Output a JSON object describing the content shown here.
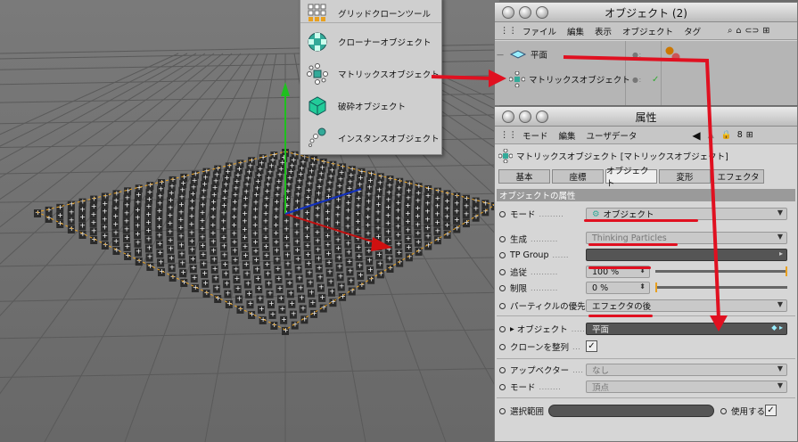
{
  "popup": {
    "items": [
      {
        "label": "グリッドクローンツール",
        "icon": "grid-clone-icon"
      },
      {
        "label": "クローナーオブジェクト",
        "icon": "cloner-icon"
      },
      {
        "label": "マトリックスオブジェクト",
        "icon": "matrix-icon"
      },
      {
        "label": "破砕オブジェクト",
        "icon": "fracture-icon"
      },
      {
        "label": "インスタンスオブジェクト",
        "icon": "instance-icon"
      }
    ]
  },
  "objects_window": {
    "title": "オブジェクト (2)",
    "menu": [
      "ファイル",
      "編集",
      "表示",
      "オブジェクト",
      "タグ"
    ],
    "rows": [
      {
        "name": "平面"
      },
      {
        "name": "マトリックスオブジェクト"
      }
    ]
  },
  "attributes": {
    "title": "属性",
    "menu": [
      "モード",
      "編集",
      "ユーザデータ"
    ],
    "object_header": "マトリックスオブジェクト [マトリックスオブジェクト]",
    "tabs": [
      "基本",
      "座標",
      "オブジェクト",
      "変形",
      "エフェクタ"
    ],
    "active_tab": "オブジェクト",
    "section": "オブジェクトの属性",
    "fields": {
      "mode_label": "モード",
      "mode_value": "オブジェクト",
      "gen_label": "生成",
      "gen_value": "Thinking Particles",
      "tp_label": "TP Group",
      "follow_label": "追従",
      "follow_value": "100 %",
      "limit_label": "制限",
      "limit_value": "0 %",
      "priority_label": "パーティクルの優先",
      "priority_value": "エフェクタの後",
      "object_label": "オブジェクト",
      "object_value": "平面",
      "align_label": "クローンを整列",
      "up_label": "アップベクター",
      "up_value": "なし",
      "mode2_label": "モード",
      "mode2_value": "頂点",
      "sel_label": "選択範囲",
      "use_label": "使用する"
    }
  }
}
